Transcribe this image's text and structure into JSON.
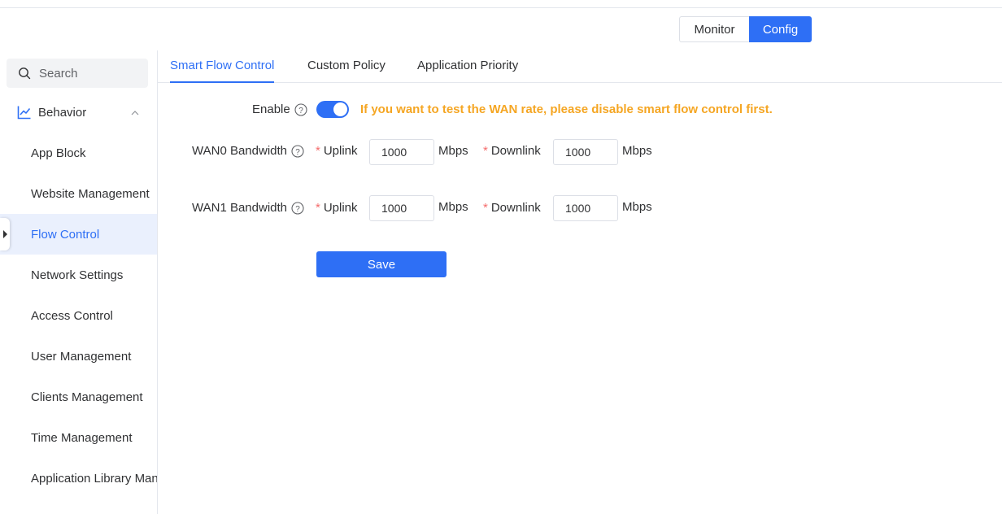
{
  "mode": {
    "monitor": "Monitor",
    "config": "Config",
    "selected": "Config"
  },
  "sidebar": {
    "search_placeholder": "Search",
    "group": "Behavior",
    "items": [
      {
        "label": "App Block"
      },
      {
        "label": "Website Management"
      },
      {
        "label": "Flow Control",
        "active": true
      },
      {
        "label": "Network Settings"
      },
      {
        "label": "Access Control"
      },
      {
        "label": "User Management"
      },
      {
        "label": "Clients Management"
      },
      {
        "label": "Time Management"
      },
      {
        "label": "Application Library Management"
      }
    ]
  },
  "tabs": [
    {
      "label": "Smart Flow Control",
      "active": true
    },
    {
      "label": "Custom Policy"
    },
    {
      "label": "Application Priority"
    }
  ],
  "form": {
    "enable_label": "Enable",
    "enabled": true,
    "warning": "If you want to test the WAN rate, please disable smart flow control first.",
    "wan0": {
      "label": "WAN0 Bandwidth",
      "uplink_label": "Uplink",
      "uplink": "1000",
      "downlink_label": "Downlink",
      "downlink": "1000",
      "unit": "Mbps"
    },
    "wan1": {
      "label": "WAN1 Bandwidth",
      "uplink_label": "Uplink",
      "uplink": "1000",
      "downlink_label": "Downlink",
      "downlink": "1000",
      "unit": "Mbps"
    },
    "required_mark": "*",
    "save_label": "Save"
  },
  "colors": {
    "accent": "#2e6ff5",
    "warning": "#f5a623",
    "required": "#f56c6c",
    "active_bg": "#eaf0fd"
  }
}
